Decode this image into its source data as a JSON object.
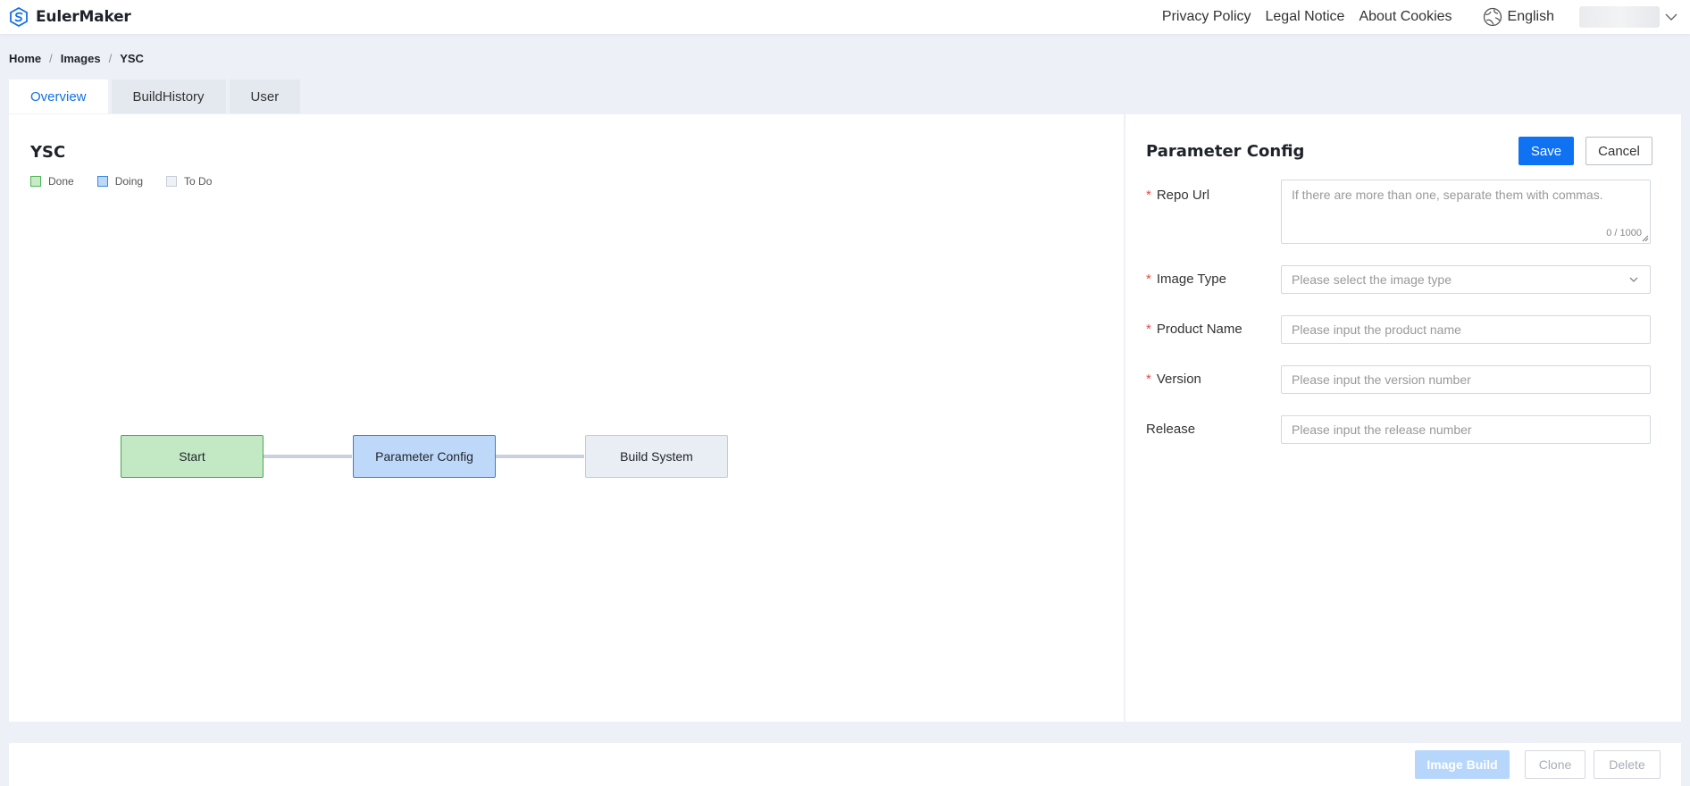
{
  "header": {
    "brand": "EulerMaker",
    "links": [
      "Privacy Policy",
      "Legal Notice",
      "About Cookies"
    ],
    "language": "English"
  },
  "breadcrumb": [
    "Home",
    "Images",
    "YSC"
  ],
  "tabs": [
    {
      "label": "Overview",
      "active": true
    },
    {
      "label": "BuildHistory",
      "active": false
    },
    {
      "label": "User",
      "active": false
    }
  ],
  "flow": {
    "title": "YSC",
    "legend": [
      "Done",
      "Doing",
      "To Do"
    ],
    "nodes": [
      {
        "label": "Start",
        "state": "done"
      },
      {
        "label": "Parameter Config",
        "state": "doing"
      },
      {
        "label": "Build System",
        "state": "todo"
      }
    ]
  },
  "config": {
    "title": "Parameter Config",
    "save_label": "Save",
    "cancel_label": "Cancel",
    "fields": {
      "repo_url": {
        "label": "Repo Url",
        "placeholder": "If there are more than one, separate them with commas.",
        "counter": "0 / 1000",
        "required": true
      },
      "image_type": {
        "label": "Image Type",
        "placeholder": "Please select the image type",
        "required": true
      },
      "product_name": {
        "label": "Product Name",
        "placeholder": "Please input the product name",
        "required": true
      },
      "version": {
        "label": "Version",
        "placeholder": "Please input the version number",
        "required": true
      },
      "release": {
        "label": "Release",
        "placeholder": "Please input the release number",
        "required": false
      }
    }
  },
  "footer": {
    "image_build": "Image Build",
    "clone": "Clone",
    "delete": "Delete"
  },
  "colors": {
    "accent": "#0f72f2",
    "done": "#c3e9c4",
    "doing": "#bed8fa",
    "todo": "#e9edf4",
    "required": "#e84a4a"
  }
}
